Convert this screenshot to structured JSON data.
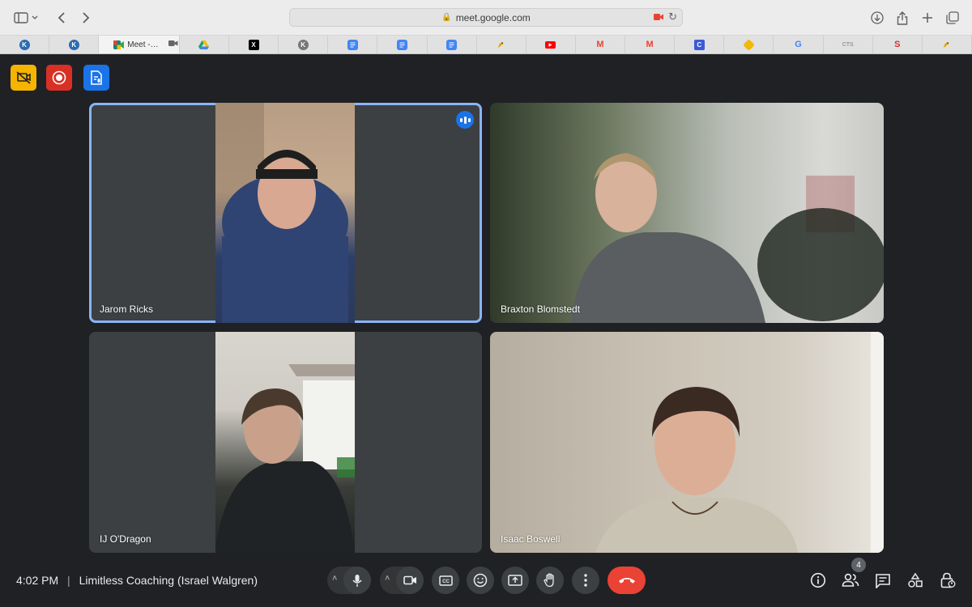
{
  "browser": {
    "url": "meet.google.com",
    "active_tab_label": "Meet -…",
    "tabs": [
      {
        "icon": "k-icon",
        "letter": "K",
        "color": "#2b6cb0"
      },
      {
        "icon": "k-icon",
        "letter": "K",
        "color": "#2b6cb0"
      },
      {
        "icon": "google-meet-icon",
        "active": true
      },
      {
        "icon": "google-drive-icon",
        "color": "#1fa463"
      },
      {
        "icon": "x-icon",
        "letter": "X",
        "color": "#000000"
      },
      {
        "icon": "k-gray-icon",
        "letter": "K",
        "color": "#777777"
      },
      {
        "icon": "google-docs-icon",
        "color": "#4285f4"
      },
      {
        "icon": "google-docs-icon",
        "color": "#4285f4"
      },
      {
        "icon": "google-docs-icon",
        "color": "#4285f4"
      },
      {
        "icon": "bird-icon",
        "color": "#222222"
      },
      {
        "icon": "youtube-icon",
        "color": "#ff0000"
      },
      {
        "icon": "gmail-icon",
        "letter": "M",
        "color": "#ea4335"
      },
      {
        "icon": "gmail-icon",
        "letter": "M",
        "color": "#ea4335"
      },
      {
        "icon": "c-icon",
        "letter": "C",
        "color": "#3b5bdb"
      },
      {
        "icon": "binance-icon",
        "color": "#f0b90b"
      },
      {
        "icon": "google-icon",
        "letter": "G",
        "color": "#4285f4"
      },
      {
        "icon": "cts-icon",
        "letter": "CTS",
        "color": "#999999"
      },
      {
        "icon": "s-icon",
        "letter": "S",
        "color": "#d32f2f"
      },
      {
        "icon": "bird-icon",
        "color": "#222222"
      }
    ]
  },
  "extensions": [
    {
      "name": "camera-off-extension",
      "color": "#f4b400"
    },
    {
      "name": "record-extension",
      "color": "#d93025"
    },
    {
      "name": "transcript-extension",
      "color": "#1a73e8"
    }
  ],
  "participants": [
    {
      "name": "Jarom Ricks",
      "speaking": true
    },
    {
      "name": "Braxton Blomstedt",
      "speaking": false
    },
    {
      "name": "IJ O'Dragon",
      "speaking": false
    },
    {
      "name": "Isaac Boswell",
      "speaking": false
    }
  ],
  "meeting": {
    "time": "4:02 PM",
    "separator": "|",
    "title": "Limitless Coaching (Israel Walgren)",
    "people_count": "4"
  },
  "colors": {
    "background": "#202124",
    "accent": "#8ab4f8",
    "end_call": "#ea4335"
  }
}
